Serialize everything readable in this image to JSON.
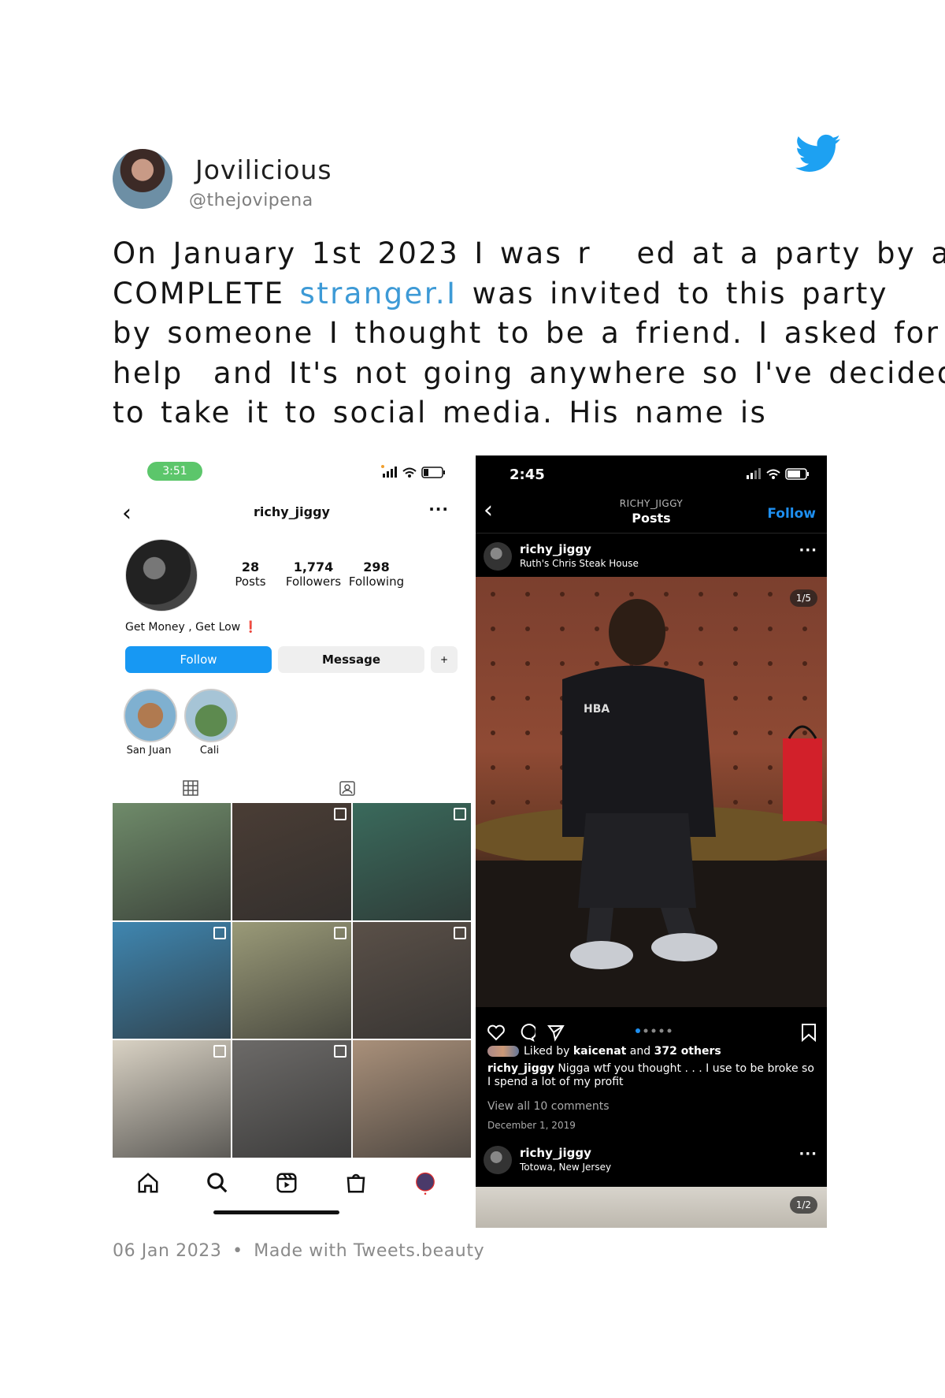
{
  "tweet": {
    "author_name": "Jovilicious",
    "handle": "@thejovipena",
    "lines": [
      "On January 1st 2023 I was r   ed at a party by a",
      "was invited to this party",
      "by someone I thought to be a friend. I asked for",
      "help  and It's not going anywhere so I've decided",
      "to take it to social media. His name is              ."
    ],
    "line2_prefix": "COMPLETE ",
    "line2_highlight": "stranger.I ",
    "date": "06 Jan 2023",
    "separator": "•",
    "made_with": "Made with Tweets.beauty",
    "brand_color": "#1DA1F2"
  },
  "left_screenshot": {
    "status_time": "3:51",
    "username": "richy_jiggy",
    "more": "···",
    "back": "‹",
    "stats": [
      {
        "num": "28",
        "label": "Posts"
      },
      {
        "num": "1,774",
        "label": "Followers"
      },
      {
        "num": "298",
        "label": "Following"
      }
    ],
    "bio": "Get Money , Get Low",
    "bio_mark": "❗",
    "follow_btn": "Follow",
    "message_btn": "Message",
    "add_btn": "+",
    "highlights": [
      "San Juan",
      "Cali"
    ],
    "grid_colors": [
      "#6f8b6a",
      "#4a3d35",
      "#3a6a5c",
      "#3f86b0",
      "#9a9a78",
      "#5a5048",
      "#d9d2c4",
      "#6c6a68",
      "#a9907a"
    ]
  },
  "right_screenshot": {
    "status_time": "2:45",
    "header_user": "RICHY_JIGGY",
    "header_title": "Posts",
    "follow": "Follow",
    "back": "‹",
    "post1": {
      "user": "richy_jiggy",
      "location": "Ruth's Chris Steak House",
      "counter": "1/5",
      "liked_prefix": "Liked by",
      "liked_user": "kaicenat",
      "liked_mid": "and",
      "liked_others": "372 others",
      "caption_user": "richy_jiggy",
      "caption_text": "Nigga wtf you thought . . . I use to be broke so I spend a lot of my profit",
      "view_comments": "View all 10 comments",
      "date": "December 1, 2019",
      "shirt_text": "HBA"
    },
    "post2": {
      "user": "richy_jiggy",
      "location": "Totowa, New Jersey",
      "counter": "1/2"
    },
    "more": "···"
  }
}
